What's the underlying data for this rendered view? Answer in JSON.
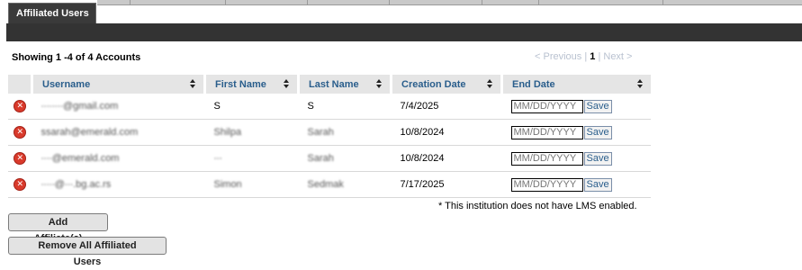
{
  "tabs": {
    "active_label": "Affiliated Users"
  },
  "summary": {
    "prefix": "Showing",
    "range_start": "1",
    "range_end": "-4",
    "of_word": "of",
    "total": "4",
    "suffix": "Accounts"
  },
  "pager": {
    "previous": "< Previous",
    "current_page": "1",
    "next": "Next >"
  },
  "columns": [
    "Username",
    "First Name",
    "Last Name",
    "Creation Date",
    "End Date"
  ],
  "rows": [
    {
      "username": "∙∙∙∙∙∙∙∙@gmail.com",
      "first_name": "S",
      "last_name": "S",
      "creation_date": "7/4/2025"
    },
    {
      "username": "ssarah@emerald.com",
      "first_name": "Shilpa",
      "last_name": "Sarah",
      "creation_date": "10/8/2024"
    },
    {
      "username": "∙∙∙∙@emerald.com",
      "first_name": "∙∙∙",
      "last_name": "Sarah",
      "creation_date": "10/8/2024"
    },
    {
      "username": "∙∙∙∙∙@∙∙∙.bg.ac.rs",
      "first_name": "Simon",
      "last_name": "Sedmak",
      "creation_date": "7/17/2025"
    }
  ],
  "end_date": {
    "placeholder": "MM/DD/YYYY",
    "save_label": "Save"
  },
  "lms_note": "* This institution does not have LMS enabled.",
  "buttons": {
    "add_affiliates": "Add Affiliate(s)",
    "remove_all": "Remove All Affiliated Users"
  },
  "icons": {
    "delete": "delete-x-icon",
    "sort": "sort-arrows-icon"
  },
  "colors": {
    "header_text": "#2a5e8c",
    "dark_bar": "#333333",
    "delete": "#d93a2b"
  }
}
